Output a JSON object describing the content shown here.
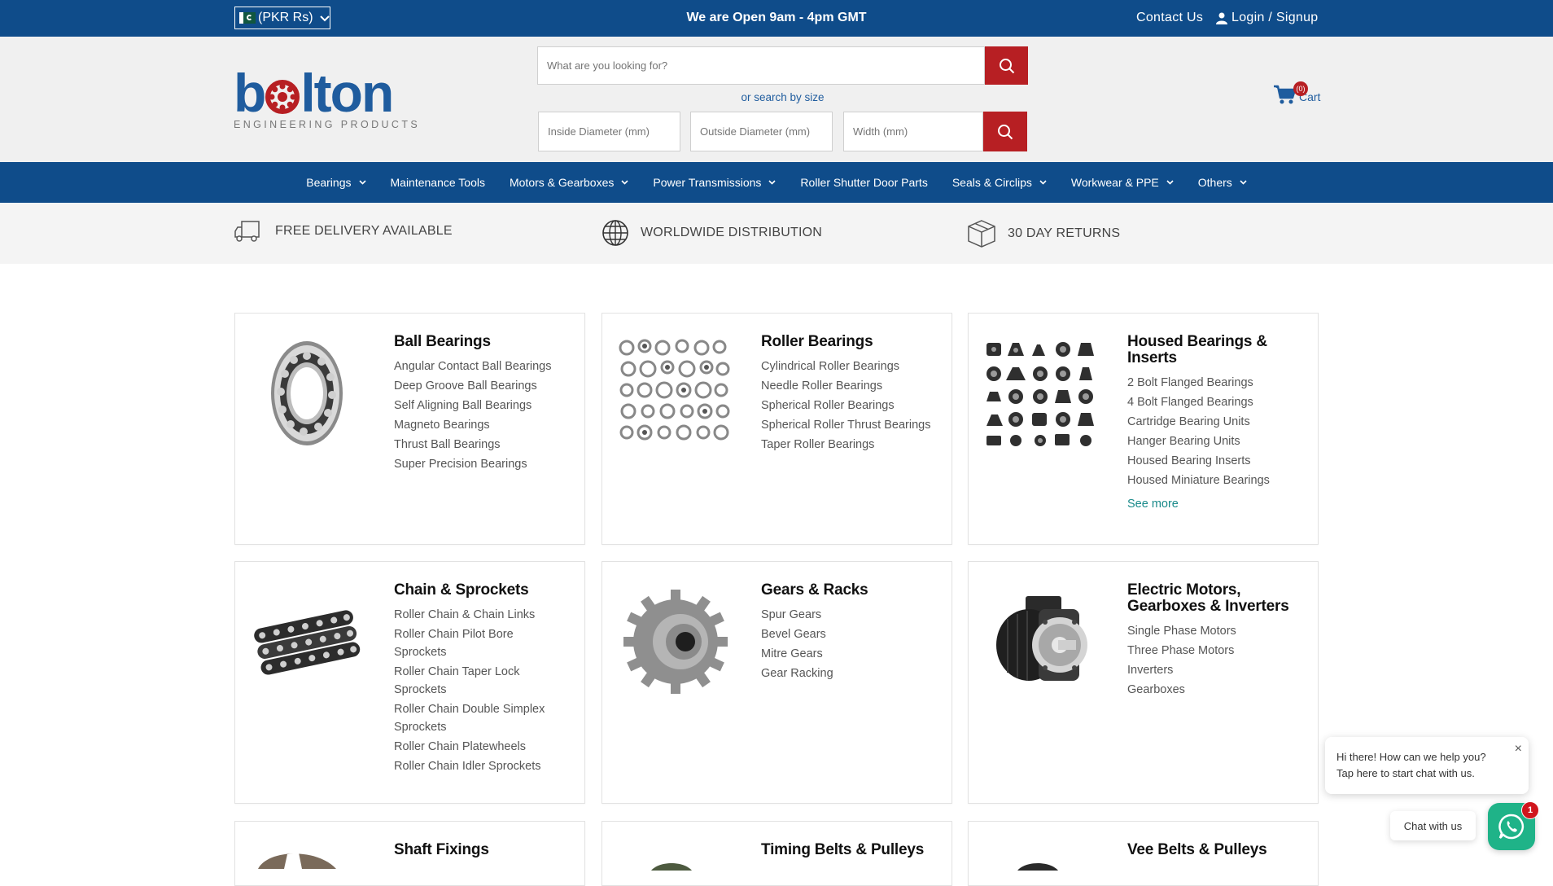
{
  "topbar": {
    "currency": "(PKR Rs)",
    "open_hours": "We are Open 9am - 4pm GMT",
    "contact": "Contact Us",
    "login": "Login / Signup"
  },
  "header": {
    "logo_text": "bolton",
    "logo_subtitle": "ENGINEERING PRODUCTS",
    "search_placeholder": "What are you looking for?",
    "size_link": "or search by size",
    "inside_diameter_placeholder": "Inside Diameter (mm)",
    "outside_diameter_placeholder": "Outside Diameter (mm)",
    "width_placeholder": "Width (mm)",
    "cart_label": "Cart",
    "cart_count": "(0)"
  },
  "nav": {
    "items": [
      {
        "label": "Bearings",
        "dropdown": true
      },
      {
        "label": "Maintenance Tools",
        "dropdown": false
      },
      {
        "label": "Motors & Gearboxes",
        "dropdown": true
      },
      {
        "label": "Power Transmissions",
        "dropdown": true
      },
      {
        "label": "Roller Shutter Door Parts",
        "dropdown": false
      },
      {
        "label": "Seals & Circlips",
        "dropdown": true
      },
      {
        "label": "Workwear & PPE",
        "dropdown": true
      },
      {
        "label": "Others",
        "dropdown": true
      }
    ]
  },
  "features": {
    "delivery": "FREE DELIVERY AVAILABLE",
    "worldwide": "WORLDWIDE DISTRIBUTION",
    "returns": "30 DAY RETURNS"
  },
  "categories": {
    "ball_bearings": {
      "title": "Ball Bearings",
      "links": [
        "Angular Contact Ball Bearings",
        "Deep Groove Ball Bearings",
        "Self Aligning Ball Bearings",
        "Magneto Bearings",
        "Thrust Ball Bearings",
        "Super Precision Bearings"
      ]
    },
    "roller_bearings": {
      "title": "Roller Bearings",
      "links": [
        "Cylindrical Roller Bearings",
        "Needle Roller Bearings",
        "Spherical Roller Bearings",
        "Spherical Roller Thrust Bearings",
        "Taper Roller Bearings"
      ]
    },
    "housed_bearings": {
      "title": "Housed Bearings & Inserts",
      "links": [
        "2 Bolt Flanged Bearings",
        "4 Bolt Flanged Bearings",
        "Cartridge Bearing Units",
        "Hanger Bearing Units",
        "Housed Bearing Inserts",
        "Housed Miniature Bearings"
      ],
      "see_more": "See more"
    },
    "chain_sprockets": {
      "title": "Chain & Sprockets",
      "links": [
        "Roller Chain & Chain Links",
        "Roller Chain Pilot Bore Sprockets",
        "Roller Chain Taper Lock Sprockets",
        "Roller Chain Double Simplex Sprockets",
        "Roller Chain Platewheels",
        "Roller Chain Idler Sprockets"
      ]
    },
    "gears_racks": {
      "title": "Gears & Racks",
      "links": [
        "Spur Gears",
        "Bevel Gears",
        "Mitre Gears",
        "Gear Racking"
      ]
    },
    "electric_motors": {
      "title": "Electric Motors, Gearboxes & Inverters",
      "links": [
        "Single Phase Motors",
        "Three Phase Motors",
        "Inverters",
        "Gearboxes"
      ]
    },
    "shaft_fixings": {
      "title": "Shaft Fixings"
    },
    "timing_belts": {
      "title": "Timing Belts & Pulleys"
    },
    "vee_belts": {
      "title": "Vee Belts & Pulleys"
    }
  },
  "chat": {
    "greeting_line1": "Hi there! How can we help you?",
    "greeting_line2": "Tap here to start chat with us.",
    "chat_label": "Chat with us",
    "unread_count": "1"
  },
  "colors": {
    "primary_blue": "#0f4c8a",
    "brand_red": "#b71f23",
    "whatsapp_green": "#1fb388",
    "link_teal": "#1a8a8a"
  }
}
